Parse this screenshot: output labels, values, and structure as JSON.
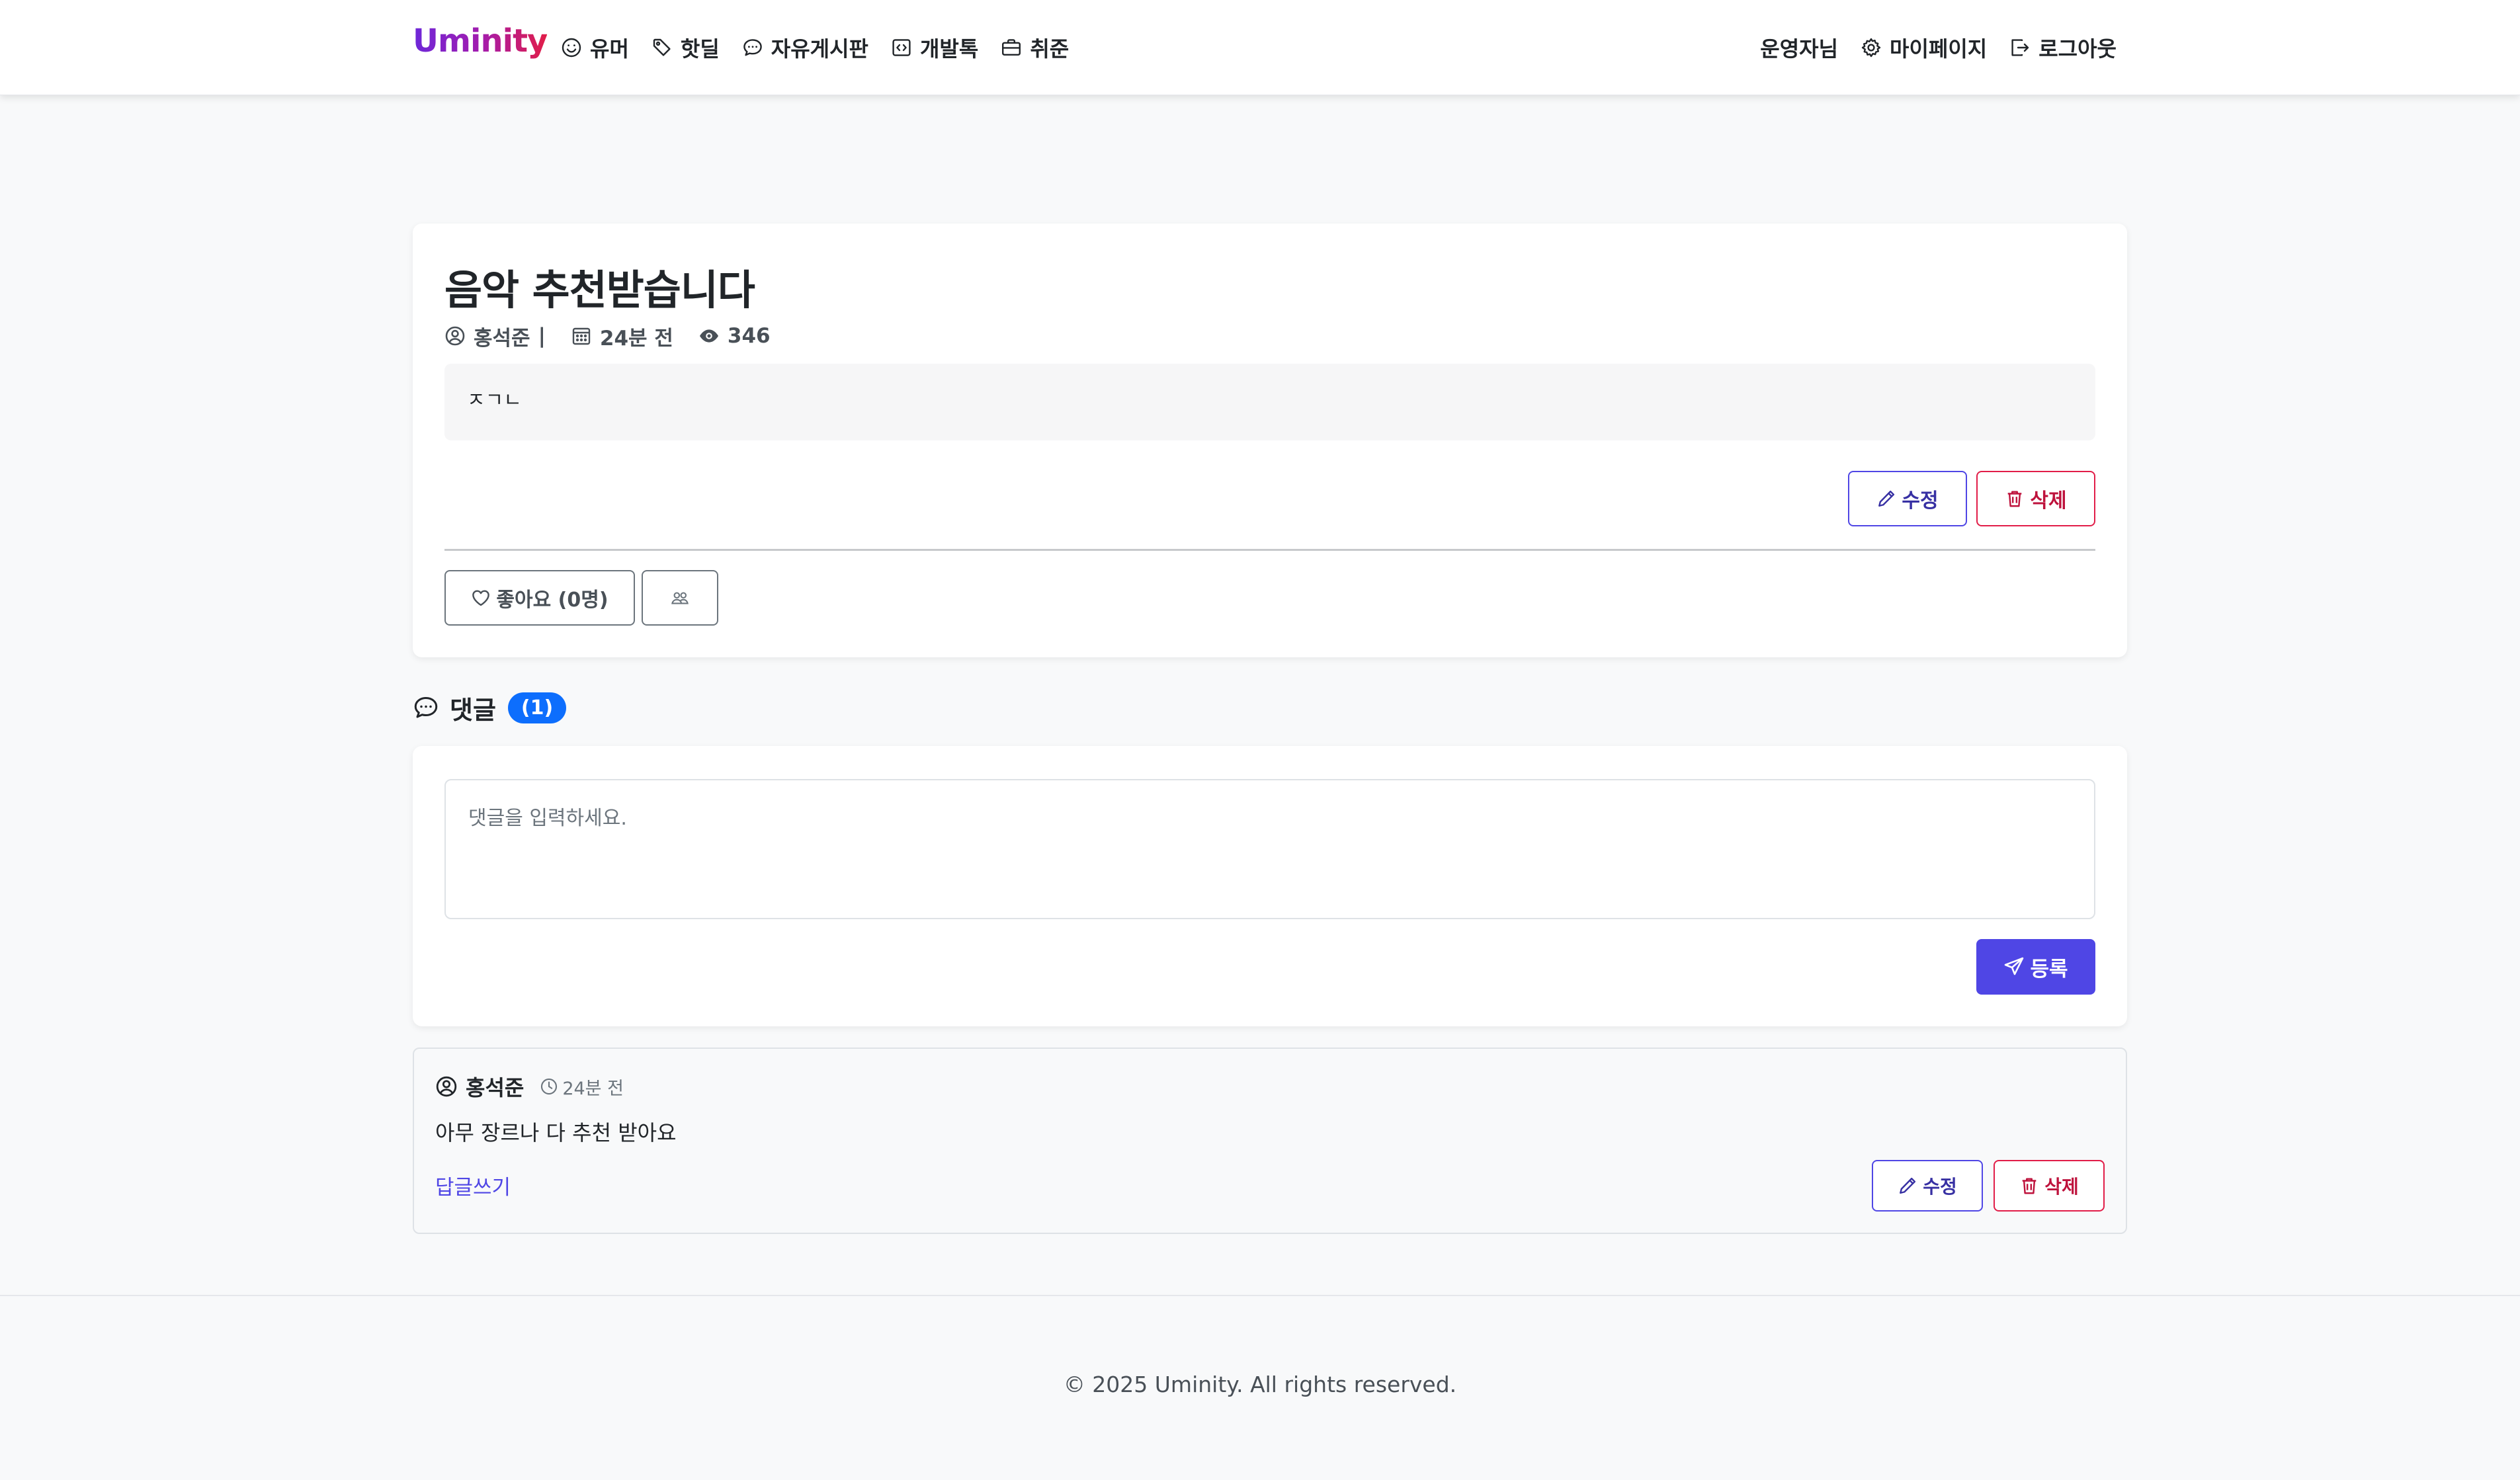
{
  "navbar": {
    "brand": "Uminity",
    "menu": [
      {
        "label": "유머",
        "icon": "smile-icon"
      },
      {
        "label": "핫딜",
        "icon": "tag-icon"
      },
      {
        "label": "자유게시판",
        "icon": "chat-dots-icon"
      },
      {
        "label": "개발톡",
        "icon": "code-icon"
      },
      {
        "label": "취준",
        "icon": "briefcase-icon"
      }
    ],
    "user_greeting": "운영자님",
    "mypage_label": "마이페이지",
    "logout_label": "로그아웃"
  },
  "post": {
    "title": "음악 추천받습니다",
    "author": "홍석준",
    "separator": "|",
    "date": "24분 전",
    "views": "346",
    "body": "ㅈㄱㄴ",
    "edit_label": "수정",
    "delete_label": "삭제",
    "like_label": "좋아요 (0명)"
  },
  "comments": {
    "heading": "댓글",
    "count": "(1)",
    "placeholder": "댓글을 입력하세요.",
    "submit_label": "등록",
    "items": [
      {
        "author": "홍석준",
        "time": "24분 전",
        "text": "아무 장르나 다 추천 받아요",
        "reply_label": "답글쓰기",
        "edit_label": "수정",
        "delete_label": "삭제"
      }
    ]
  },
  "footer": {
    "copyright": "© 2025 Uminity. All rights reserved."
  },
  "colors": {
    "primary": "#4f46e5",
    "danger": "#e11d48",
    "badge": "#0d6efd"
  }
}
